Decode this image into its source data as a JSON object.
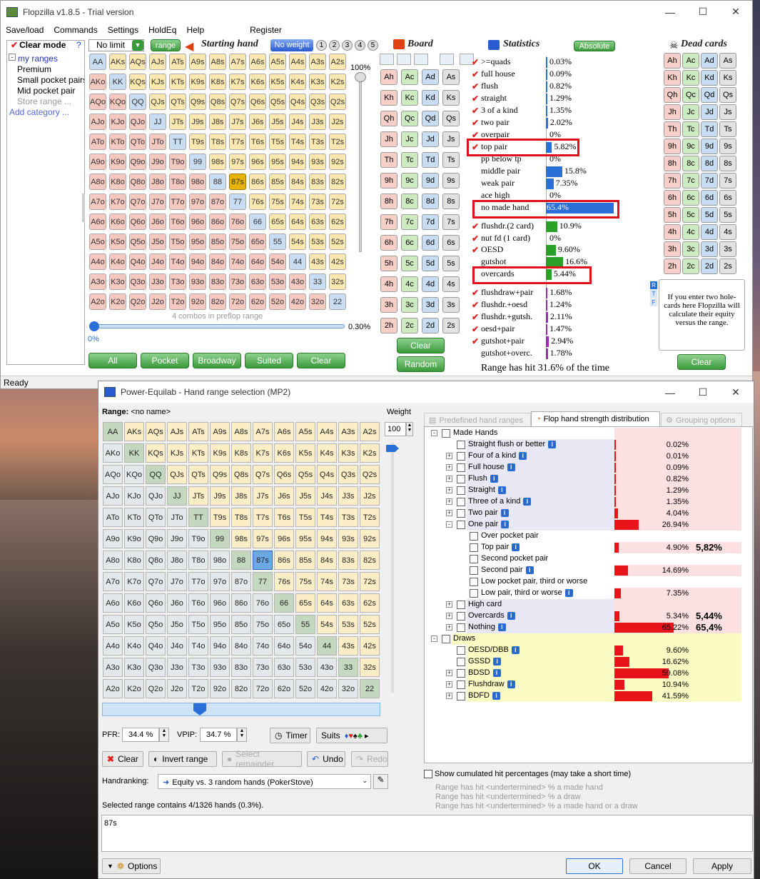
{
  "flopzilla": {
    "title": "Flopzilla v1.8.5 - Trial version",
    "menu": [
      "Save/load",
      "Commands",
      "Settings",
      "HoldEq",
      "Help",
      "Register"
    ],
    "clear_mode": "Clear mode",
    "help": "?",
    "tree": {
      "root": "my ranges",
      "items": [
        "Premium",
        "Small pocket pairs",
        "Mid pocket pair",
        "Store range ...",
        "Add category ..."
      ]
    },
    "no_limit": "No limit",
    "range_btn": "range",
    "starting_hand": "Starting hand",
    "no_weight": "No weight",
    "weights": [
      "1",
      "2",
      "3",
      "4",
      "5"
    ],
    "slider_top": "100%",
    "combos_label": "4 combos in preflop range",
    "pct_left": "0%",
    "pct_right": "0.30%",
    "bottom_buttons": [
      "All",
      "Pocket",
      "Broadway",
      "Suited",
      "Clear"
    ],
    "status": "Ready",
    "board_title": "Board",
    "board_buttons": [
      "Clear",
      "Random"
    ],
    "stats_title": "Statistics",
    "absolute_btn": "Absolute",
    "dead_title": "Dead cards",
    "dead_clear": "Clear",
    "dead_info": "If you enter two hole-cards here Flopzilla will calculate their equity versus the range.",
    "tabs_letters": [
      "R",
      "T",
      "F"
    ],
    "range_hit": "Range has hit 31.6% of the time",
    "stats": [
      {
        "name": ">=quads",
        "val": "0.03%",
        "pct": 0.03,
        "chk": true
      },
      {
        "name": "full house",
        "val": "0.09%",
        "pct": 0.09,
        "chk": true
      },
      {
        "name": "flush",
        "val": "0.82%",
        "pct": 0.82,
        "chk": true
      },
      {
        "name": "straight",
        "val": "1.29%",
        "pct": 1.29,
        "chk": true
      },
      {
        "name": "3 of a kind",
        "val": "1.35%",
        "pct": 1.35,
        "chk": true
      },
      {
        "name": "two pair",
        "val": "2.02%",
        "pct": 2.02,
        "chk": true
      },
      {
        "name": "overpair",
        "val": "0%",
        "pct": 0,
        "chk": true
      },
      {
        "name": "top pair",
        "val": "5.82%",
        "pct": 5.82,
        "chk": true
      },
      {
        "name": "pp below tp",
        "val": "0%",
        "pct": 0,
        "chk": false
      },
      {
        "name": "middle pair",
        "val": "15.8%",
        "pct": 15.8,
        "chk": false
      },
      {
        "name": "weak pair",
        "val": "7.35%",
        "pct": 7.35,
        "chk": false
      },
      {
        "name": "ace high",
        "val": "0%",
        "pct": 0,
        "chk": false
      },
      {
        "name": "no made hand",
        "val": "65.4%",
        "pct": 65.4,
        "chk": false
      },
      {
        "name": "flushdr.(2 card)",
        "val": "10.9%",
        "pct": 10.9,
        "chk": true
      },
      {
        "name": "nut fd (1 card)",
        "val": "0%",
        "pct": 0,
        "chk": true
      },
      {
        "name": "OESD",
        "val": "9.60%",
        "pct": 9.6,
        "chk": true
      },
      {
        "name": "gutshot",
        "val": "16.6%",
        "pct": 16.6,
        "chk": false
      },
      {
        "name": "overcards",
        "val": "5.44%",
        "pct": 5.44,
        "chk": false
      },
      {
        "name": "flushdraw+pair",
        "val": "1.68%",
        "pct": 1.68,
        "chk": true
      },
      {
        "name": "flushdr.+oesd",
        "val": "1.24%",
        "pct": 1.24,
        "chk": true
      },
      {
        "name": "flushdr.+gutsh.",
        "val": "2.11%",
        "pct": 2.11,
        "chk": true
      },
      {
        "name": "oesd+pair",
        "val": "1.47%",
        "pct": 1.47,
        "chk": true
      },
      {
        "name": "gutshot+pair",
        "val": "2.94%",
        "pct": 2.94,
        "chk": true
      },
      {
        "name": "gutshot+overc.",
        "val": "1.78%",
        "pct": 1.78,
        "chk": false
      }
    ]
  },
  "equilab": {
    "title": "Power-Equilab - Hand range selection (MP2)",
    "range_label": "Range:",
    "range_name": "<no name>",
    "weight_label": "Weight",
    "weight_value": "100",
    "tabs": [
      "Predefined hand ranges",
      "Flop hand strength distribution",
      "Grouping options"
    ],
    "pfr_label": "PFR:",
    "pfr_value": "34.4 %",
    "vpip_label": "VPIP:",
    "vpip_value": "34.7 %",
    "timer": "Timer",
    "suits": "Suits",
    "clear": "Clear",
    "invert": "Invert range",
    "select_remainder": "Select remainder",
    "undo": "Undo",
    "redo": "Redo",
    "handranking_label": "Handranking:",
    "handranking_value": "Equity vs. 3 random hands (PokerStove)",
    "selected_text": "Selected range contains 4/1326 hands (0.3%).",
    "range_text": "87s",
    "show_cumulated": "Show cumulated hit percentages (may take a short time)",
    "hit_lines": [
      "Range has hit <undertermined> % a made hand",
      "Range has hit <undertermined> % a draw",
      "Range has hit <undertermined> % a made hand or a draw"
    ],
    "options": "Options",
    "ok": "OK",
    "cancel": "Cancel",
    "apply": "Apply",
    "tree": [
      {
        "label": "Made Hands",
        "level": 0,
        "pct": null,
        "val": "",
        "pm": "-",
        "info": false,
        "head": true
      },
      {
        "label": "Straight flush or better",
        "level": 1,
        "pct": 0.02,
        "val": "0.02%",
        "pm": "",
        "info": true
      },
      {
        "label": "Four of a kind",
        "level": 1,
        "pct": 0.01,
        "val": "0.01%",
        "pm": "+",
        "info": true
      },
      {
        "label": "Full house",
        "level": 1,
        "pct": 0.09,
        "val": "0.09%",
        "pm": "+",
        "info": true
      },
      {
        "label": "Flush",
        "level": 1,
        "pct": 0.82,
        "val": "0.82%",
        "pm": "+",
        "info": true
      },
      {
        "label": "Straight",
        "level": 1,
        "pct": 1.29,
        "val": "1.29%",
        "pm": "+",
        "info": true
      },
      {
        "label": "Three of a kind",
        "level": 1,
        "pct": 1.35,
        "val": "1.35%",
        "pm": "+",
        "info": true
      },
      {
        "label": "Two pair",
        "level": 1,
        "pct": 4.04,
        "val": "4.04%",
        "pm": "+",
        "info": true
      },
      {
        "label": "One pair",
        "level": 1,
        "pct": 26.94,
        "val": "26.94%",
        "pm": "-",
        "info": true
      },
      {
        "label": "Over pocket pair",
        "level": 2,
        "pct": null,
        "val": "",
        "pm": "",
        "info": false
      },
      {
        "label": "Top pair",
        "level": 2,
        "pct": 4.9,
        "val": "4.90%",
        "pm": "",
        "info": true,
        "extra": "5,82%"
      },
      {
        "label": "Second pocket pair",
        "level": 2,
        "pct": null,
        "val": "",
        "pm": "",
        "info": false
      },
      {
        "label": "Second pair",
        "level": 2,
        "pct": 14.69,
        "val": "14.69%",
        "pm": "",
        "info": true
      },
      {
        "label": "Low pocket pair, third or worse",
        "level": 2,
        "pct": null,
        "val": "",
        "pm": "",
        "info": false
      },
      {
        "label": "Low pair, third or worse",
        "level": 2,
        "pct": 7.35,
        "val": "7.35%",
        "pm": "",
        "info": true
      },
      {
        "label": "High card",
        "level": 1,
        "pct": null,
        "val": "",
        "pm": "+",
        "info": false
      },
      {
        "label": "Overcards",
        "level": 1,
        "pct": 5.34,
        "val": "5.34%",
        "pm": "+",
        "info": true,
        "extra": "5,44%"
      },
      {
        "label": "Nothing",
        "level": 1,
        "pct": 65.22,
        "val": "65.22%",
        "pm": "+",
        "info": true,
        "extra": "65,4%"
      },
      {
        "label": "Draws",
        "level": 0,
        "pct": null,
        "val": "",
        "pm": "-",
        "info": false,
        "head": true,
        "draw": true
      },
      {
        "label": "OESD/DBB",
        "level": 1,
        "pct": 9.6,
        "val": "9.60%",
        "pm": "",
        "info": true,
        "draw": true
      },
      {
        "label": "GSSD",
        "level": 1,
        "pct": 16.62,
        "val": "16.62%",
        "pm": "",
        "info": true,
        "draw": true
      },
      {
        "label": "BDSD",
        "level": 1,
        "pct": 59.08,
        "val": "59.08%",
        "pm": "+",
        "info": true,
        "draw": true
      },
      {
        "label": "Flushdraw",
        "level": 1,
        "pct": 10.94,
        "val": "10.94%",
        "pm": "+",
        "info": true,
        "draw": true
      },
      {
        "label": "BDFD",
        "level": 1,
        "pct": 41.59,
        "val": "41.59%",
        "pm": "+",
        "info": true,
        "draw": true
      }
    ]
  },
  "ranks": [
    "A",
    "K",
    "Q",
    "J",
    "T",
    "9",
    "8",
    "7",
    "6",
    "5",
    "4",
    "3",
    "2"
  ],
  "selected_hand": "87s",
  "colors": {
    "highlight_red": "#e0101a",
    "green": "#3a9a3a",
    "stat_bar": "#2a6fd8"
  }
}
